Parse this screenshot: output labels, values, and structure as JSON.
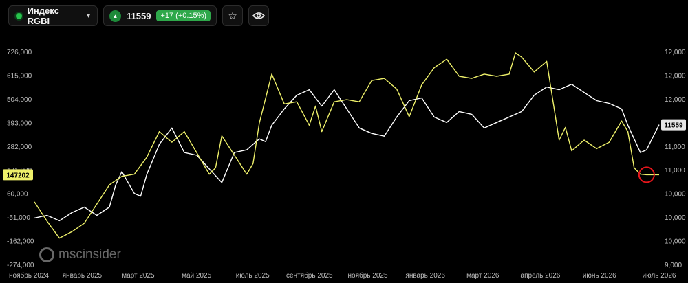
{
  "header": {
    "index_name": "Индекс RGBI",
    "price": "11559",
    "change": "+17 (+0.15%)",
    "colors": {
      "status_dot": "#27c24c",
      "change_bg": "#2ea84a"
    },
    "icons": [
      "chevron-down-icon",
      "triangle-up-icon",
      "star-icon",
      "eye-icon"
    ]
  },
  "logo": {
    "text": "mscinsider"
  },
  "chart_data": {
    "type": "line",
    "x_ticks": [
      "ноябрь 2024",
      "январь 2025",
      "март 2025",
      "май 2025",
      "июль 2025",
      "сентябрь 2025",
      "ноябрь 2025",
      "январь 2026",
      "март 2026",
      "апрель 2026",
      "июнь 2026",
      "июль 2026"
    ],
    "left_axis": {
      "ticks": [
        "726,000",
        "615,000",
        "504,000",
        "393,000",
        "282,000",
        "171,000",
        "60,000",
        "-51,000",
        "-162,000",
        "-274,000"
      ],
      "ylim": [
        -274000,
        726000
      ]
    },
    "right_axis": {
      "ticks": [
        "12,000",
        "12,000",
        "12,000",
        "12,000",
        "11,000",
        "11,000",
        "10,000",
        "10,000",
        "10,000",
        "9,000"
      ],
      "ylim": [
        9000,
        12900
      ]
    },
    "left_badge": "147202",
    "right_badge": "11559",
    "series": [
      {
        "axis": "right",
        "color": "#ffffff",
        "x": [
          0,
          2,
          4,
          6,
          8,
          10,
          12,
          13,
          14,
          15,
          16,
          17,
          18,
          20,
          22,
          24,
          26,
          28,
          30,
          32,
          34,
          36,
          37,
          38,
          40,
          42,
          44,
          46,
          48,
          50,
          52,
          54,
          56,
          58,
          60,
          62,
          64,
          66,
          68,
          70,
          72,
          74,
          76,
          78,
          80,
          82,
          84,
          86,
          88,
          90,
          92,
          94,
          95,
          96,
          97,
          98,
          100
        ],
        "y": [
          9850,
          9900,
          9800,
          9950,
          10050,
          9900,
          10050,
          10450,
          10700,
          10500,
          10300,
          10250,
          10650,
          11200,
          11500,
          11050,
          11000,
          10750,
          10500,
          11050,
          11100,
          11300,
          11250,
          11550,
          11850,
          12100,
          12200,
          11900,
          12200,
          11850,
          11500,
          11400,
          11350,
          11700,
          12000,
          12050,
          11700,
          11600,
          11800,
          11750,
          11500,
          11600,
          11700,
          11800,
          12100,
          12250,
          12200,
          12300,
          12150,
          12000,
          11950,
          11850,
          11550,
          11300,
          11050,
          11100,
          11559
        ]
      },
      {
        "axis": "left",
        "color": "#eef06a",
        "x": [
          0,
          2,
          4,
          6,
          8,
          10,
          12,
          14,
          16,
          18,
          20,
          22,
          24,
          26,
          28,
          29,
          30,
          32,
          34,
          35,
          36,
          38,
          40,
          42,
          44,
          45,
          46,
          48,
          50,
          52,
          54,
          56,
          58,
          60,
          62,
          64,
          66,
          68,
          70,
          72,
          74,
          76,
          77,
          78,
          80,
          82,
          84,
          85,
          86,
          88,
          90,
          92,
          94,
          95,
          96,
          97,
          98,
          100
        ],
        "y": [
          20000,
          -70000,
          -150000,
          -120000,
          -80000,
          10000,
          100000,
          140000,
          150000,
          230000,
          350000,
          300000,
          350000,
          250000,
          150000,
          180000,
          330000,
          240000,
          150000,
          200000,
          390000,
          620000,
          480000,
          490000,
          380000,
          470000,
          350000,
          490000,
          500000,
          490000,
          590000,
          600000,
          550000,
          420000,
          570000,
          650000,
          690000,
          610000,
          600000,
          620000,
          610000,
          620000,
          720000,
          700000,
          630000,
          680000,
          310000,
          370000,
          260000,
          310000,
          270000,
          300000,
          400000,
          350000,
          180000,
          150000,
          147202,
          147202
        ]
      }
    ],
    "marker": {
      "series": 1,
      "x": 98,
      "y": 147202,
      "color": "#e5161b"
    }
  }
}
